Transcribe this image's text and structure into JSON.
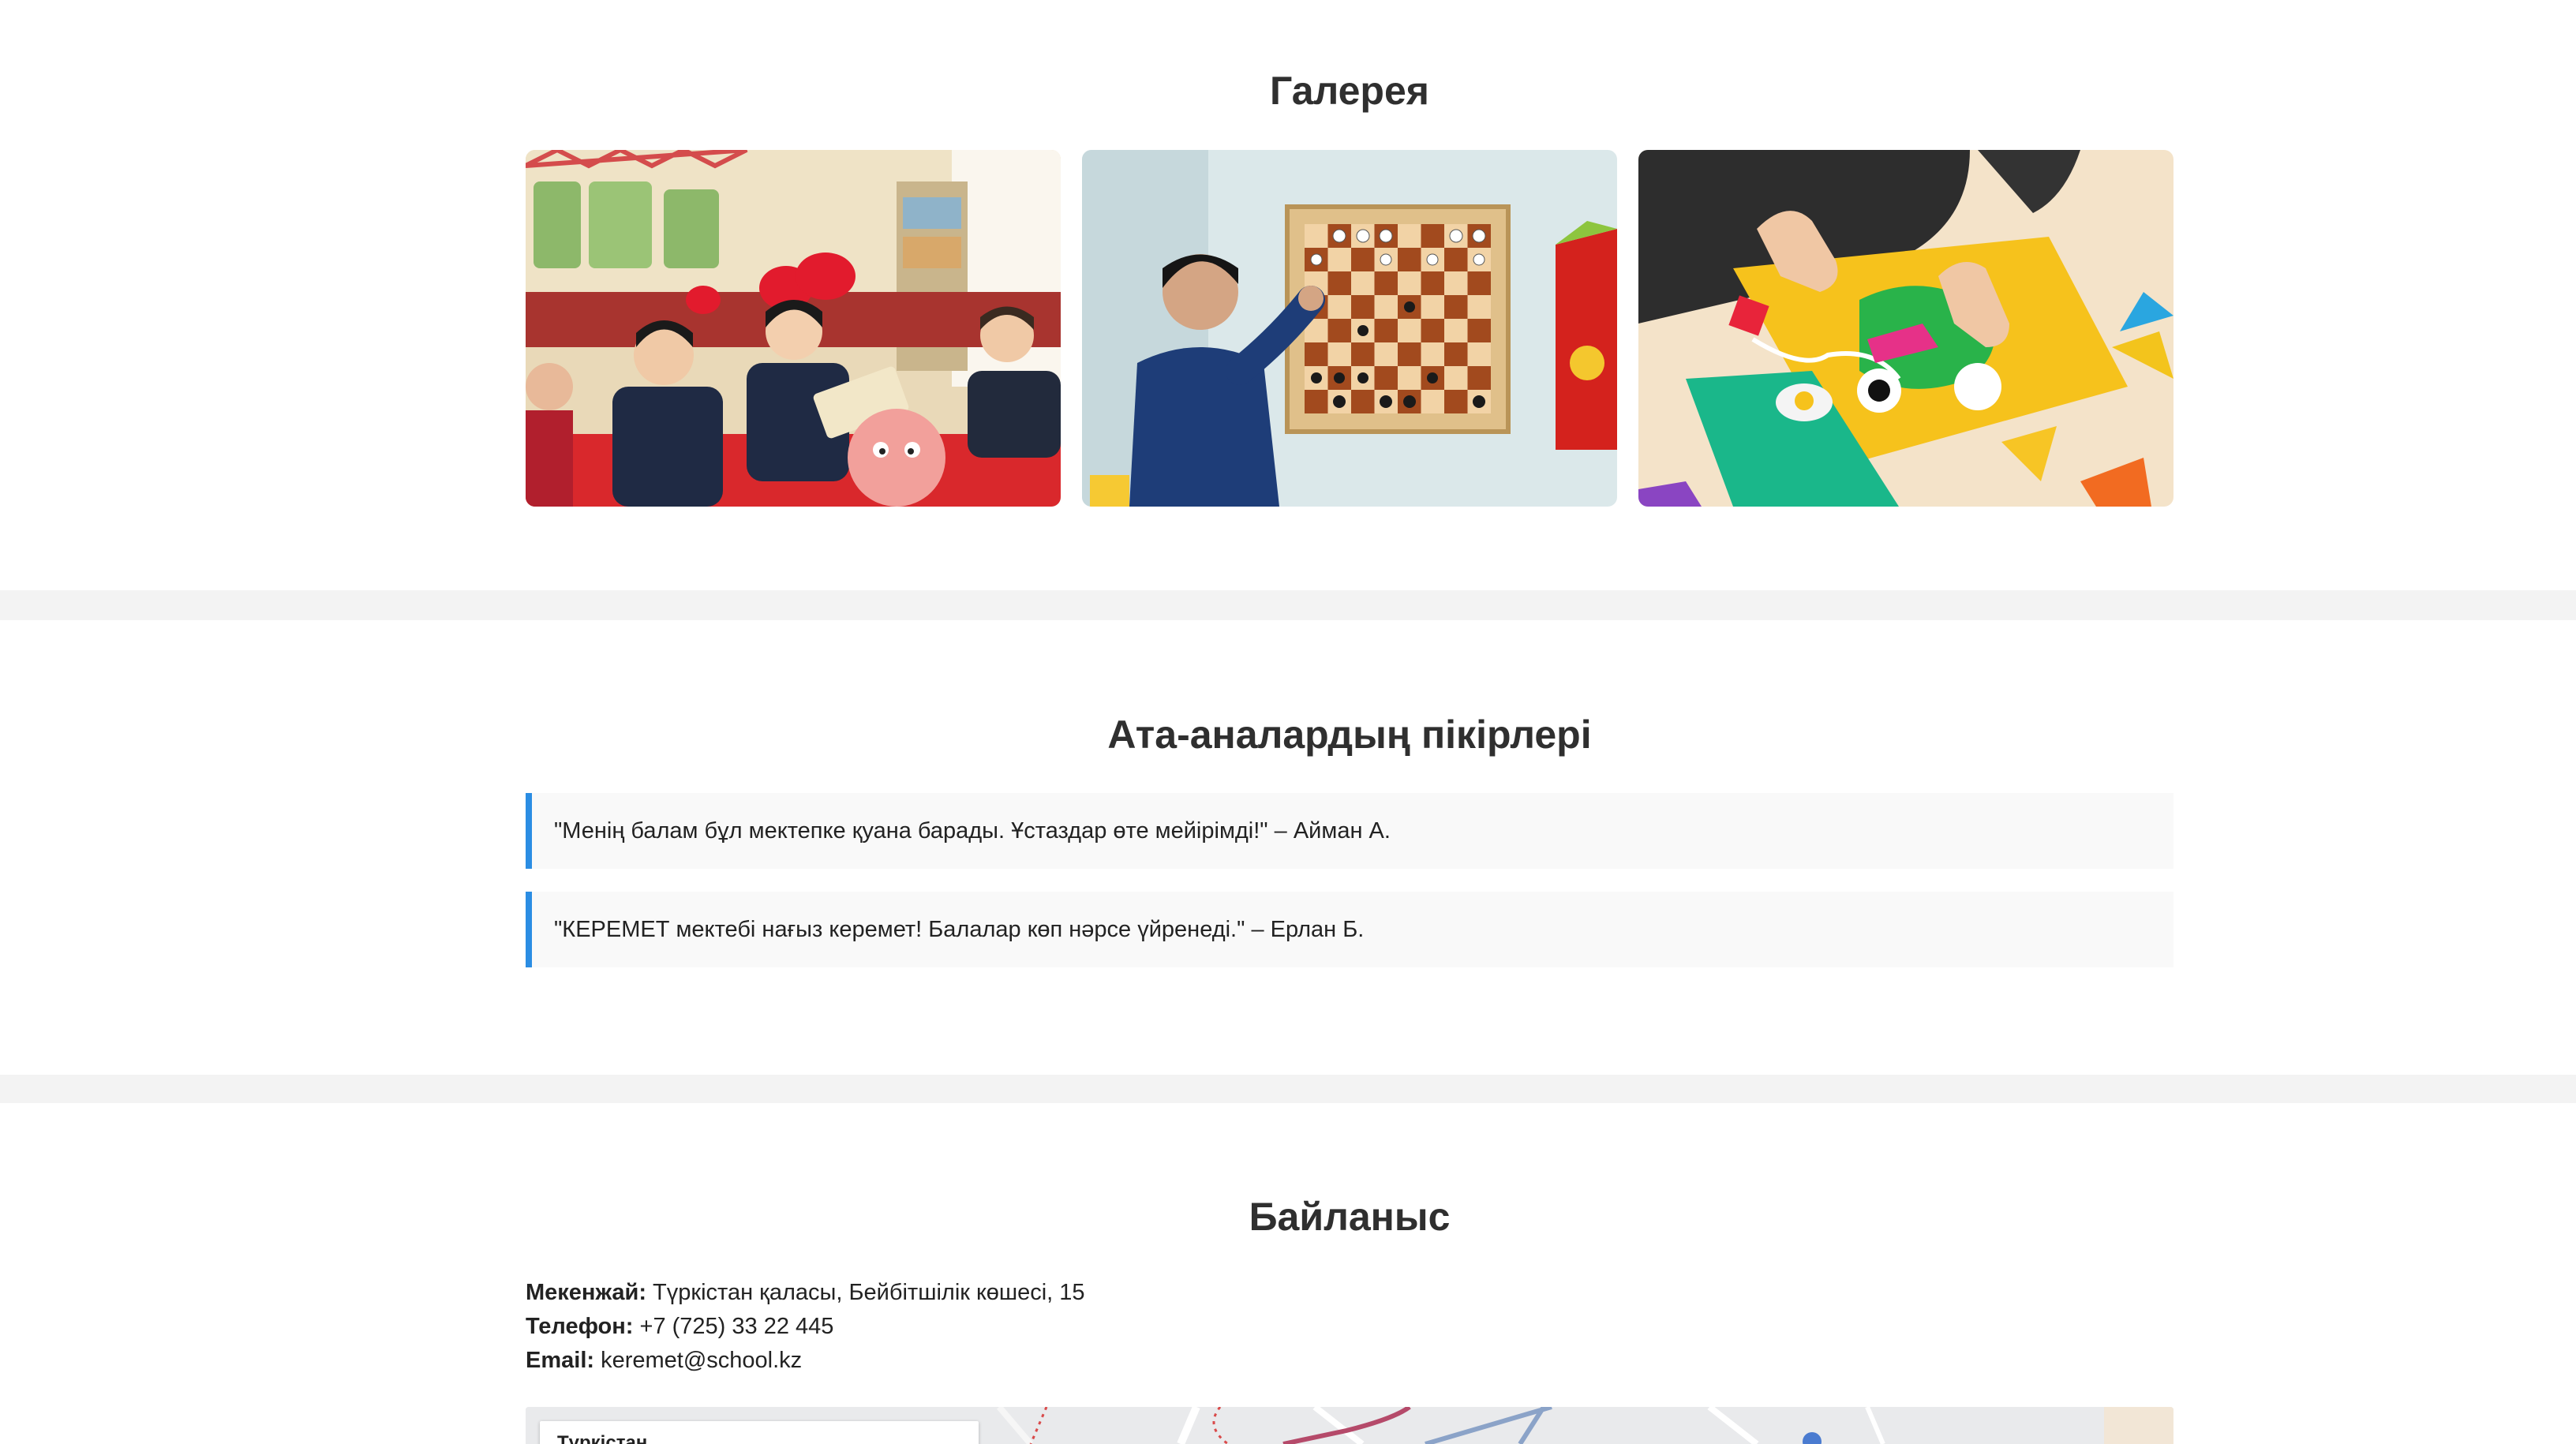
{
  "gallery": {
    "title": "Галерея",
    "images": [
      {
        "alt": "Classroom with children reading"
      },
      {
        "alt": "Boy at a wall chessboard"
      },
      {
        "alt": "Child doing a colorful craft"
      }
    ]
  },
  "testimonials": {
    "title": "Ата-аналардың пікірлері",
    "items": [
      {
        "text": "\"Менің балам бұл мектепке қуана барады. Ұстаздар өте мейірімді!\" – Айман А."
      },
      {
        "text": "\"КЕРЕМЕТ мектебі нағыз керемет! Балалар көп нәрсе үйренеді.\" – Ерлан Б."
      }
    ]
  },
  "contact": {
    "title": "Байланыс",
    "address_label": "Мекенжай:",
    "address_value": "Түркістан қаласы, Бейбітшілік көшесі, 15",
    "phone_label": "Телефон:",
    "phone_value": "+7 (725) 33 22 445",
    "email_label": "Email:",
    "email_value": "keremet@school.kz",
    "map_place": "Түркістан"
  },
  "colors": {
    "accent": "#2b8de3",
    "divider": "#f3f3f3",
    "quote_bg": "#f9f9f9"
  }
}
